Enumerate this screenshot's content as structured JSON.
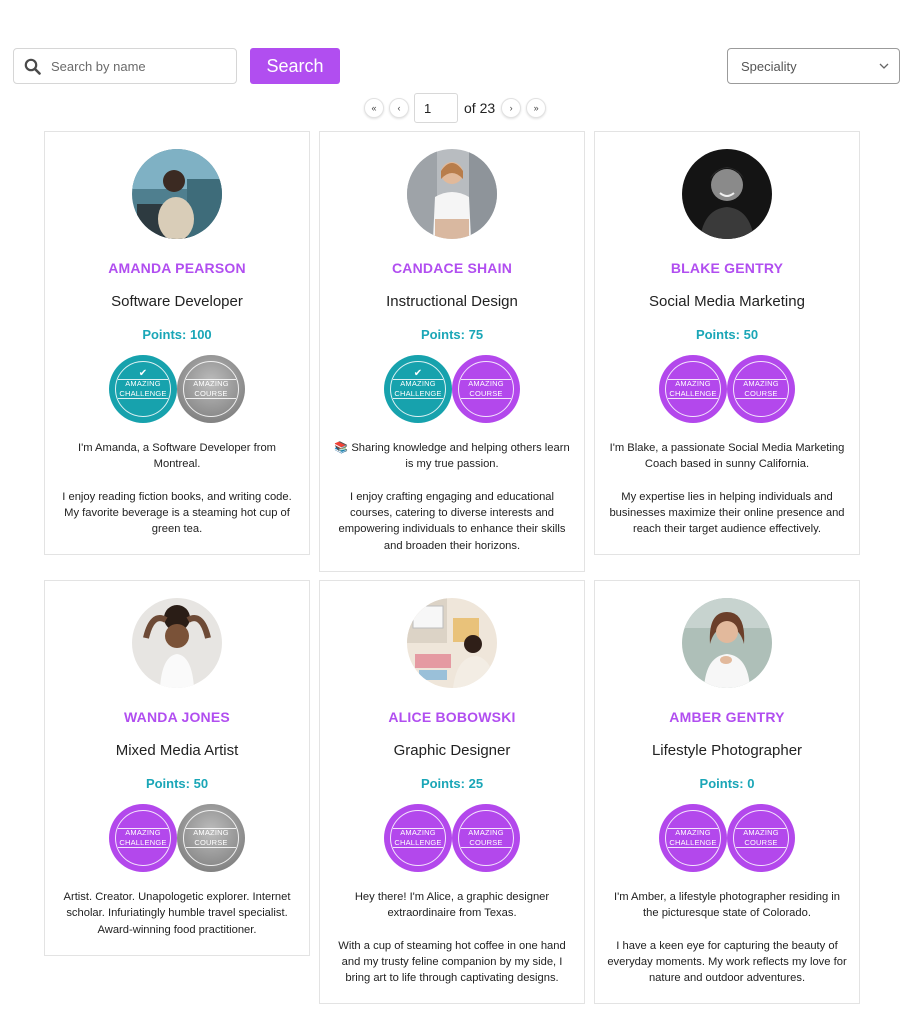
{
  "search": {
    "placeholder": "Search by name",
    "button_label": "Search"
  },
  "filter": {
    "selected": "Speciality"
  },
  "pagination": {
    "first": "«",
    "prev": "‹",
    "current_page": "1",
    "total_label": "of 23",
    "next": "›",
    "last": "»"
  },
  "badge_labels": {
    "challenge_line1": "AMAZING",
    "challenge_line2": "CHALLENGE",
    "course_line1": "AMAZING",
    "course_line2": "COURSE",
    "check": "✔"
  },
  "colors": {
    "accent_purple": "#b14ef0",
    "points_teal": "#1aa6b7",
    "badge_teal": "#17a2ad",
    "badge_gray": "#8f8f8f"
  },
  "cards": [
    {
      "name": "AMANDA PEARSON",
      "title": "Software Developer",
      "points": "Points: 100",
      "challenge_badge": "teal-earned",
      "course_badge": "gray-locked",
      "bio": [
        "I'm Amanda, a Software Developer from Montreal.",
        "I enjoy reading fiction books, and writing code. My favorite beverage is a steaming hot cup of green tea."
      ]
    },
    {
      "name": "CANDACE SHAIN",
      "title": "Instructional Design",
      "points": "Points: 75",
      "challenge_badge": "teal-earned",
      "course_badge": "purple",
      "bio": [
        "📚 Sharing knowledge and helping others learn is my true passion.",
        "I enjoy crafting engaging and educational courses, catering to diverse interests and empowering individuals to enhance their skills and broaden their horizons."
      ]
    },
    {
      "name": "BLAKE GENTRY",
      "title": "Social Media Marketing",
      "points": "Points: 50",
      "challenge_badge": "purple",
      "course_badge": "purple",
      "bio": [
        "I'm Blake, a passionate Social Media Marketing Coach based in sunny California.",
        "My expertise lies in helping individuals and businesses maximize their online presence and reach their target audience effectively."
      ]
    },
    {
      "name": "WANDA JONES",
      "title": "Mixed Media Artist",
      "points": "Points: 50",
      "challenge_badge": "purple",
      "course_badge": "gray-locked",
      "bio": [
        "Artist. Creator. Unapologetic explorer. Internet scholar. Infuriatingly humble travel specialist. Award-winning food practitioner."
      ]
    },
    {
      "name": "ALICE BOBOWSKI",
      "title": "Graphic Designer",
      "points": "Points: 25",
      "challenge_badge": "purple",
      "course_badge": "purple",
      "bio": [
        "Hey there! I'm Alice, a graphic designer extraordinaire from Texas.",
        "With a cup of steaming hot coffee in one hand and my trusty feline companion by my side, I bring art to life through captivating designs."
      ]
    },
    {
      "name": "AMBER GENTRY",
      "title": "Lifestyle Photographer",
      "points": "Points: 0",
      "challenge_badge": "purple",
      "course_badge": "purple",
      "bio": [
        "I'm Amber, a lifestyle photographer residing in the picturesque state of Colorado.",
        "I have a keen eye for capturing the beauty of everyday moments. My work reflects my love for nature and outdoor adventures."
      ]
    }
  ]
}
